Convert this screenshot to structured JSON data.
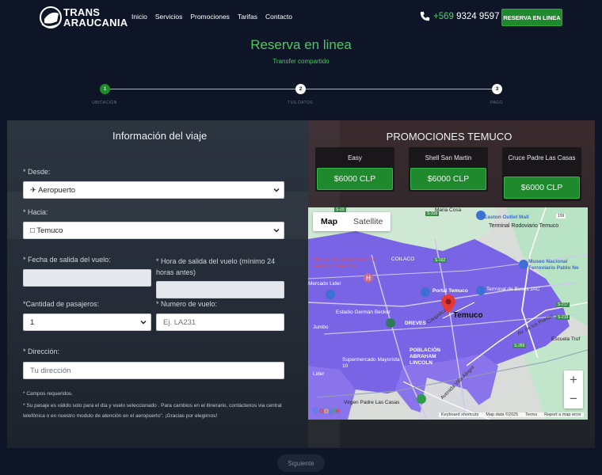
{
  "brand": {
    "line1": "TRANS",
    "line2": "ARAUCANIA"
  },
  "nav": [
    "Inicio",
    "Servicios",
    "Promociones",
    "Tarifas",
    "Contacto"
  ],
  "phone": {
    "prefix": "+569",
    "number": " 9324 9597"
  },
  "reserve_button": "RESERVA EN LINEA",
  "page": {
    "title": "Reserva en linea",
    "subtitle": "Transfer compartido"
  },
  "steps": [
    {
      "num": "1",
      "label": "UBICACIÓN"
    },
    {
      "num": "2",
      "label": "TUS DATOS"
    },
    {
      "num": "3",
      "label": "PAGO"
    }
  ],
  "form": {
    "title": "Información del viaje",
    "desde": {
      "label": "Desde:",
      "value": "✈ Aeropuerto"
    },
    "hacia": {
      "label": "Hacia:",
      "value": "□ Temuco"
    },
    "fecha": {
      "label": "Fecha de salida del vuelo:"
    },
    "hora": {
      "label": "Hora de salida del vuelo (mínimo 24 horas antes)"
    },
    "pasajeros": {
      "label": "Cantidad de pasajeros:",
      "value": "1"
    },
    "vuelo": {
      "label": "Numero de vuelo:",
      "placeholder": "Ej. LA231"
    },
    "direccion": {
      "label": "Dirección:",
      "placeholder": "Tu dirección"
    },
    "req_note": "* Campos requeridos.",
    "note": "* Su pasaje es válido solo para el dia y vuelo seleccionado . Para cambios en el itinerario, contáctenos via central telefónica o en nuestro modulo de atención en el aeropuerto\". ¡Gracias por elegirnos!"
  },
  "promotions": {
    "title": "PROMOCIONES TEMUCO",
    "items": [
      {
        "name": "Easy",
        "price": "$6000 CLP"
      },
      {
        "name": "Shell San Martin",
        "price": "$6000 CLP"
      },
      {
        "name": "Cruce Padre Las Casas",
        "price": "$6000 CLP"
      }
    ]
  },
  "map": {
    "tab_map": "Map",
    "tab_satellite": "Satellite",
    "zoom_in": "+",
    "zoom_out": "−",
    "labels": {
      "maria_cosa": "Maria Cosa",
      "easton": "Easton Outlet Mall",
      "terminal_rodoviario": "Terminal Rodoviario Temuco",
      "museo": "Museo Nacional Ferroviario Pablo Ne",
      "coilaco": "COILACO",
      "clinica": "Clínica RedSalud Mayor de Temuco - Servicios...",
      "mercado_lider": "Mercado Lider",
      "portal": "Portal Temuco",
      "terminal_jac": "Terminal de Buses JAC",
      "temuco": "Temuco",
      "jumbo": "Jumbo",
      "estadio": "Estadio Germán Becker",
      "dreves": "DREVES",
      "av_alemania": "Av. Alemania",
      "caupolican": "Caupolicán",
      "escuela": "Escuela Truf",
      "poblacion": "POBLACIÓN ABRAHAM LINCOLN",
      "supermercado": "Supermercado Mayorista 10",
      "lider": "Lider",
      "avenida_villa": "Avenida Villa Alegre",
      "virgen": "Virgen Padre Las Casas",
      "av_los_poetas": "Av. de los Poetas",
      "s316": "S-316",
      "s162": "S-162",
      "s217": "S-217",
      "s219": "S-219",
      "s269": "S-269",
      "s20": "S-20",
      "r199": "199"
    },
    "footer": {
      "shortcuts": "Keyboard shortcuts",
      "data": "Map data ©2025",
      "terms": "Terms",
      "report": "Report a map error"
    },
    "google": "Google"
  },
  "next_button": "Siguiente"
}
